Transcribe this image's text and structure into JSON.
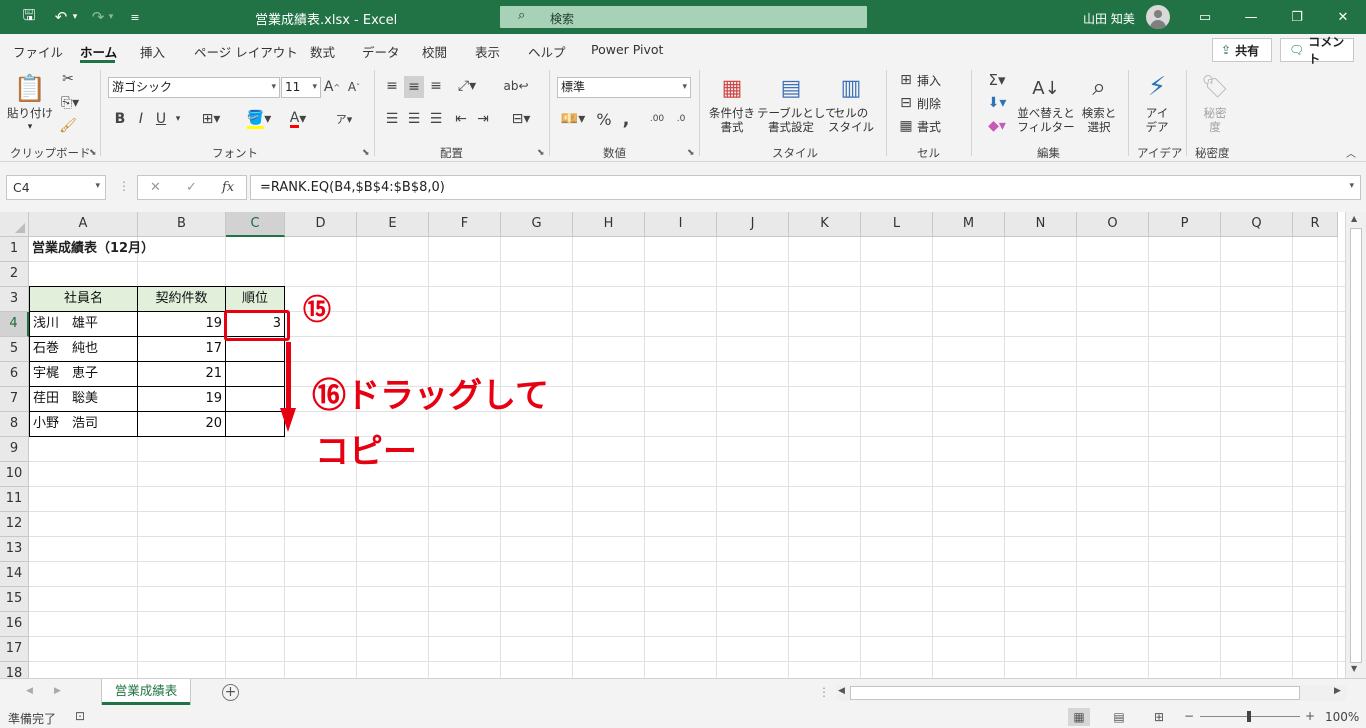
{
  "titlebar": {
    "title": "営業成績表.xlsx  -  Excel",
    "search_placeholder": "検索",
    "user_name": "山田 知美"
  },
  "menu": {
    "tabs": [
      "ファイル",
      "ホーム",
      "挿入",
      "ページ レイアウト",
      "数式",
      "データ",
      "校閲",
      "表示",
      "ヘルプ",
      "Power Pivot"
    ],
    "active": "ホーム",
    "share_label": "共有",
    "comment_label": "コメント"
  },
  "ribbon": {
    "groups": [
      "クリップボード",
      "フォント",
      "配置",
      "数値",
      "スタイル",
      "セル",
      "編集",
      "アイデア",
      "秘密度"
    ],
    "paste_label": "貼り付け",
    "font_name": "游ゴシック",
    "font_size": "11",
    "number_format": "標準",
    "cond_format_l1": "条件付き",
    "cond_format_l2": "書式",
    "table_format_l1": "テーブルとして",
    "table_format_l2": "書式設定",
    "cell_style_l1": "セルの",
    "cell_style_l2": "スタイル",
    "insert_label": "挿入",
    "delete_label": "削除",
    "format_label": "書式",
    "sort_l1": "並べ替えと",
    "sort_l2": "フィルター",
    "find_l1": "検索と",
    "find_l2": "選択",
    "ideas_l1": "アイ",
    "ideas_l2": "デア",
    "secret_l1": "秘密",
    "secret_l2": "度"
  },
  "formula_bar": {
    "name_box": "C4",
    "formula": "=RANK.EQ(B4,$B$4:$B$8,0)"
  },
  "sheet": {
    "columns": [
      "A",
      "B",
      "C",
      "D",
      "E",
      "F",
      "G",
      "H",
      "I",
      "J",
      "K",
      "L",
      "M",
      "N",
      "O",
      "P",
      "Q",
      "R"
    ],
    "rows": [
      "1",
      "2",
      "3",
      "4",
      "5",
      "6",
      "7",
      "8",
      "9",
      "10",
      "11",
      "12",
      "13",
      "14",
      "15",
      "16",
      "17",
      "18"
    ],
    "title": "営業成績表（12月）",
    "headers": [
      "社員名",
      "契約件数",
      "順位"
    ],
    "data": [
      {
        "name": "浅川　雄平",
        "count": "19",
        "rank": "3"
      },
      {
        "name": "石巻　純也",
        "count": "17",
        "rank": ""
      },
      {
        "name": "宇梶　恵子",
        "count": "21",
        "rank": ""
      },
      {
        "name": "荏田　聡美",
        "count": "19",
        "rank": ""
      },
      {
        "name": "小野　浩司",
        "count": "20",
        "rank": ""
      }
    ]
  },
  "annotations": {
    "step15": "⑮",
    "step16_line1": "⑯ドラッグして",
    "step16_line2": "コピー",
    "color": "#e60012"
  },
  "tabs": {
    "sheet_name": "営業成績表"
  },
  "status": {
    "ready": "準備完了",
    "zoom": "100%"
  },
  "colors": {
    "excel_green": "#217346",
    "header_fill": "#e2efda"
  }
}
